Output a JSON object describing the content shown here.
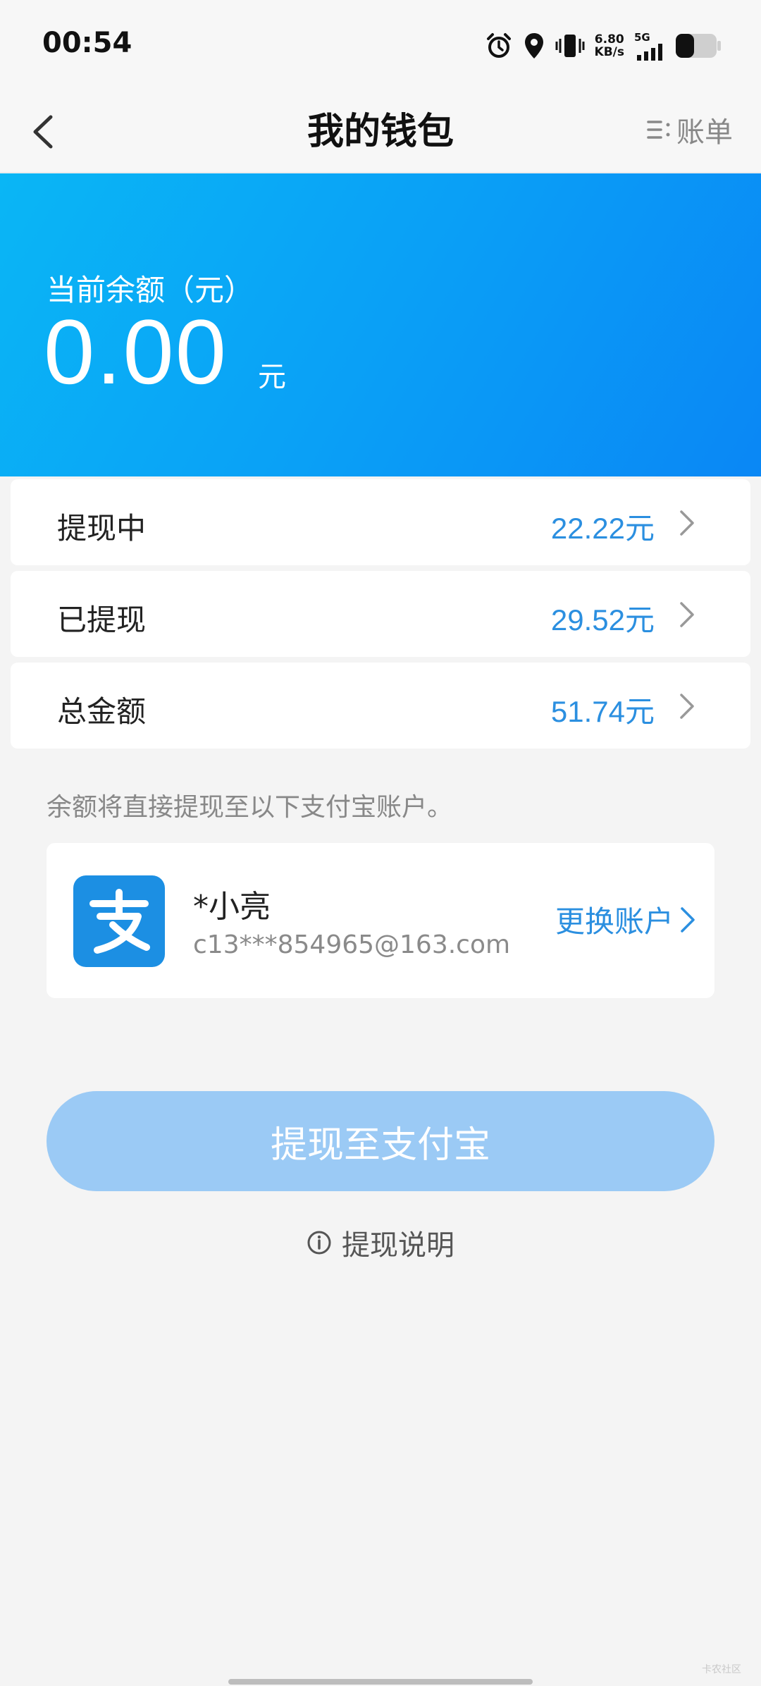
{
  "status_bar": {
    "time": "00:54",
    "net_speed_value": "6.80",
    "net_speed_unit": "KB/s",
    "network": "5G"
  },
  "nav": {
    "title": "我的钱包",
    "bill_label": "账单"
  },
  "balance": {
    "label": "当前余额（元）",
    "amount": "0.00",
    "unit": "元"
  },
  "rows": [
    {
      "label": "提现中",
      "value": "22.22元"
    },
    {
      "label": "已提现",
      "value": "29.52元"
    },
    {
      "label": "总金额",
      "value": "51.74元"
    }
  ],
  "note": "余额将直接提现至以下支付宝账户。",
  "account": {
    "logo_glyph": "支",
    "name": "*小亮",
    "email": "c13***854965@163.com",
    "change_label": "更换账户"
  },
  "withdraw_button": "提现至支付宝",
  "withdraw_info": "提现说明",
  "watermark": "卡农社区",
  "colors": {
    "accent": "#2b8fe0",
    "header_start": "#0ab6f5",
    "header_end": "#0a87f5",
    "button_disabled": "#9bcaf5"
  }
}
